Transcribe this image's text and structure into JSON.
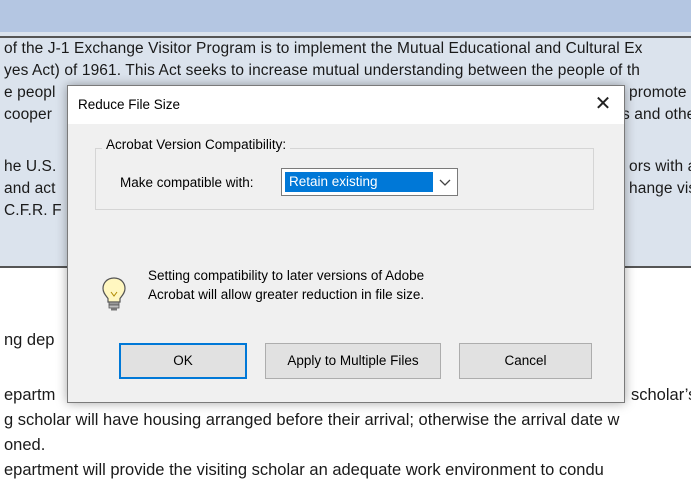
{
  "document": {
    "band_lines": [
      "of the J-1 Exchange Visitor Program is to implement the Mutual Educational and Cultural Ex",
      "yes Act) of 1961. This Act seeks to increase mutual understanding between the people of th",
      "e peopl",
      "cooper",
      "he U.S.",
      "and act",
      "C.F.R. F"
    ],
    "band_right_fragments": [
      "promote",
      "s and othe",
      "ors with a",
      "hange visi"
    ],
    "lower_lines": [
      "ng dep",
      "epartm",
      "g scholar will have housing arranged before their arrival; otherwise the arrival date w",
      "oned.",
      "epartment will provide the visiting scholar an adequate work environment to condu"
    ],
    "lower_right_fragment": "scholar’s"
  },
  "dialog": {
    "title": "Reduce File Size",
    "close_glyph": "✕",
    "group_label": "Acrobat Version Compatibility:",
    "compat_label": "Make compatible with:",
    "compat_value": "Retain existing",
    "info_line1": "Setting compatibility to later versions of Adobe",
    "info_line2": "Acrobat will allow greater reduction in file size.",
    "ok_label": "OK",
    "apply_label": "Apply to Multiple Files",
    "cancel_label": "Cancel",
    "accent_color": "#0078d7",
    "icons": {
      "info": "lightbulb-icon",
      "dropdown": "chevron-down-icon",
      "close": "close-icon"
    }
  }
}
